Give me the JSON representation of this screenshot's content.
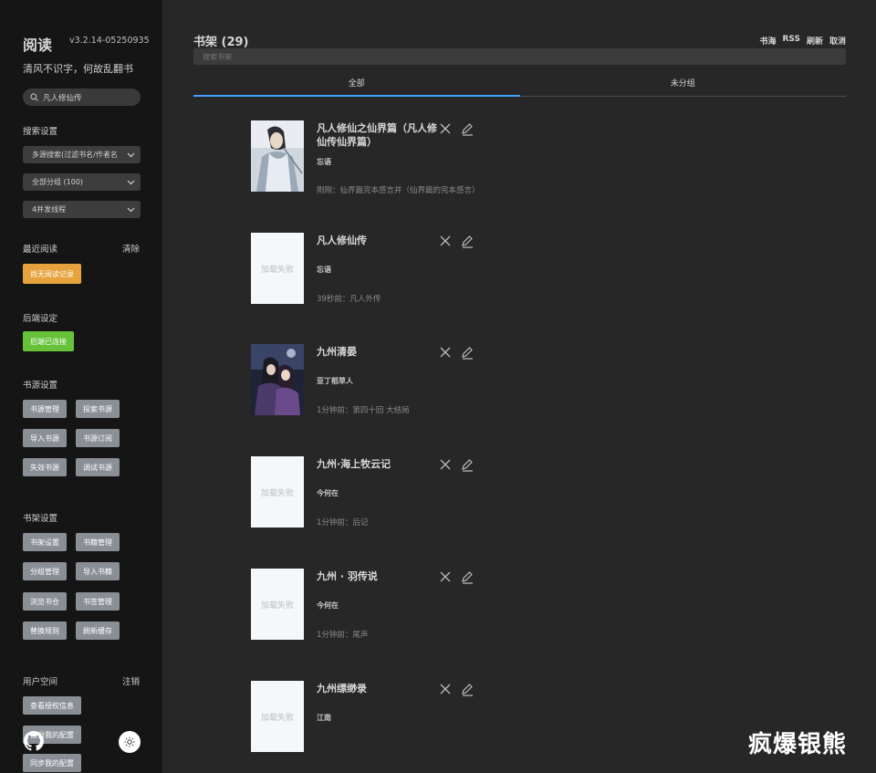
{
  "app": {
    "title": "阅读",
    "version": "v3.2.14-05250935",
    "slogan": "清风不识字，何故乱翻书"
  },
  "sidebar": {
    "search": {
      "value": "凡人修仙传",
      "placeholder": ""
    },
    "search_settings": {
      "title": "搜索设置",
      "source_select": "多源搜索(过滤书名/作者名",
      "group_select": "全部分组 (100)",
      "thread_select": "4并发线程"
    },
    "recent": {
      "title": "最近阅读",
      "clear_label": "清除",
      "empty_label": "尚无阅读记录"
    },
    "backend": {
      "title": "后端设定",
      "status_label": "后端已连接"
    },
    "source_settings": {
      "title": "书源设置",
      "buttons": [
        "书源管理",
        "探索书源",
        "导入书源",
        "书源订阅",
        "失效书源",
        "调试书源"
      ]
    },
    "shelf_settings": {
      "title": "书架设置",
      "buttons": [
        "书架设置",
        "书籍管理",
        "分组管理",
        "导入书籍",
        "浏览书仓",
        "书签管理",
        "替换规则",
        "刷新缓存"
      ]
    },
    "user": {
      "title": "用户空间",
      "logout_label": "注销",
      "buttons": [
        "查看授权信息",
        "备份我的配置",
        "同步我的配置"
      ]
    }
  },
  "main": {
    "title": "书架 (29)",
    "actions": [
      "书海",
      "RSS",
      "刷新",
      "取消"
    ],
    "search_placeholder": "搜索书架",
    "tabs": [
      "全部",
      "未分组"
    ],
    "books": [
      {
        "name": "凡人修仙之仙界篇（凡人修仙传仙界篇）",
        "author": "忘语",
        "latest": "刚刚：仙界篇完本感言并（仙界篇的完本感言）",
        "cover": "image"
      },
      {
        "name": "凡人修仙传",
        "author": "忘语",
        "latest": "39秒前：凡人外传",
        "cover": "failed"
      },
      {
        "name": "九州清晏",
        "author": "亚丁稻草人",
        "latest": "1分钟前：第四十回 大结局",
        "cover": "image"
      },
      {
        "name": "九州·海上牧云记",
        "author": "今何在",
        "latest": "1分钟前：后记",
        "cover": "failed"
      },
      {
        "name": "九州 · 羽传说",
        "author": "今何在",
        "latest": "1分钟前：尾声",
        "cover": "failed"
      },
      {
        "name": "九州缥缈录",
        "author": "江南",
        "latest": "",
        "cover": "failed"
      }
    ],
    "cover_failed_label": "加载失败"
  },
  "watermark": "疯爆银熊",
  "colors": {
    "background": "#272727",
    "sidebar": "#151515",
    "accent": "#409eff",
    "warning": "#e6a23c",
    "success": "#67c23a",
    "button": "#8a8f96"
  }
}
